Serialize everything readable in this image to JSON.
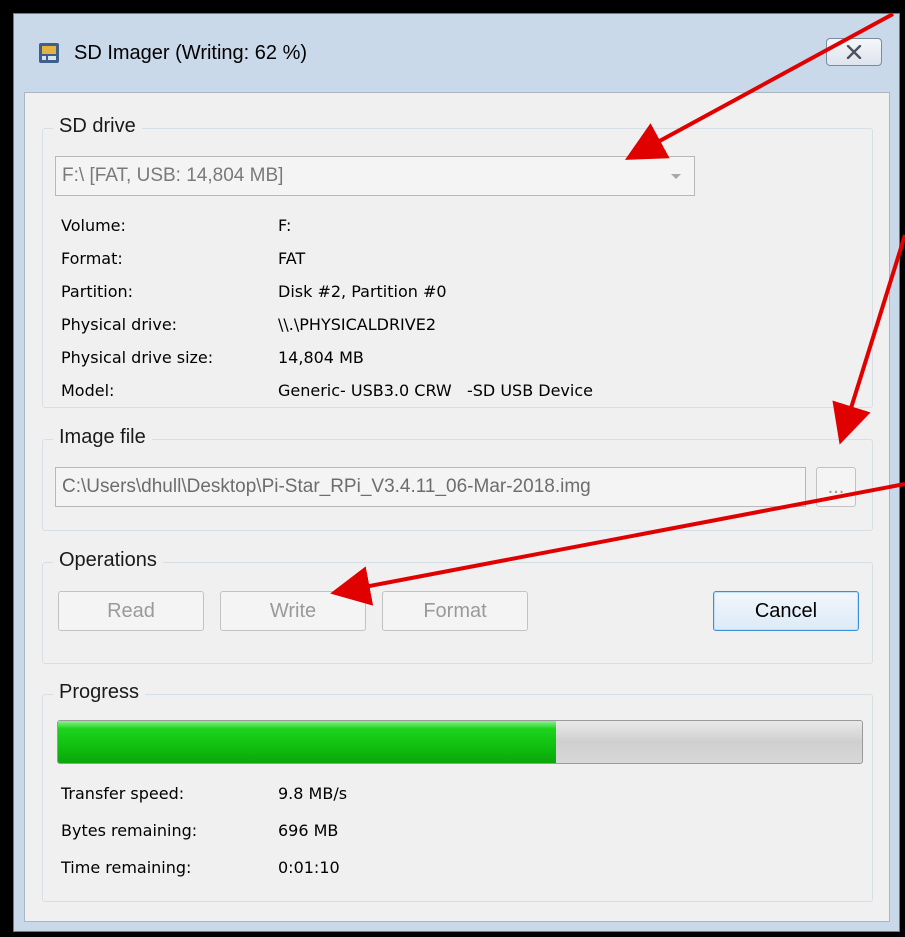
{
  "window": {
    "title": "SD Imager (Writing: 62 %)",
    "close_icon": "close-icon",
    "app_icon": "sd-card-icon"
  },
  "sd_drive": {
    "group_title": "SD drive",
    "selected": "F:\\ [FAT, USB: 14,804 MB]",
    "info": [
      {
        "label": "Volume:",
        "value": "F:"
      },
      {
        "label": "Format:",
        "value": "FAT"
      },
      {
        "label": "Partition:",
        "value": "Disk #2, Partition #0"
      },
      {
        "label": "Physical drive:",
        "value": "\\\\.\\PHYSICALDRIVE2"
      },
      {
        "label": "Physical drive size:",
        "value": "14,804 MB"
      },
      {
        "label": "Model:",
        "value": "Generic- USB3.0 CRW   -SD USB Device"
      }
    ]
  },
  "image_file": {
    "group_title": "Image file",
    "path": "C:\\Users\\dhull\\Desktop\\Pi-Star_RPi_V3.4.11_06-Mar-2018.img",
    "browse_label": "..."
  },
  "operations": {
    "group_title": "Operations",
    "read_label": "Read",
    "write_label": "Write",
    "format_label": "Format",
    "cancel_label": "Cancel"
  },
  "progress": {
    "group_title": "Progress",
    "percent": 62,
    "info": [
      {
        "label": "Transfer speed:",
        "value": "9.8 MB/s"
      },
      {
        "label": "Bytes remaining:",
        "value": "696 MB"
      },
      {
        "label": "Time remaining:",
        "value": "0:01:10"
      }
    ]
  },
  "colors": {
    "annotation_arrow": "#e00000",
    "progress_fill": "#10c010",
    "focus_border": "#3c8fd6"
  }
}
